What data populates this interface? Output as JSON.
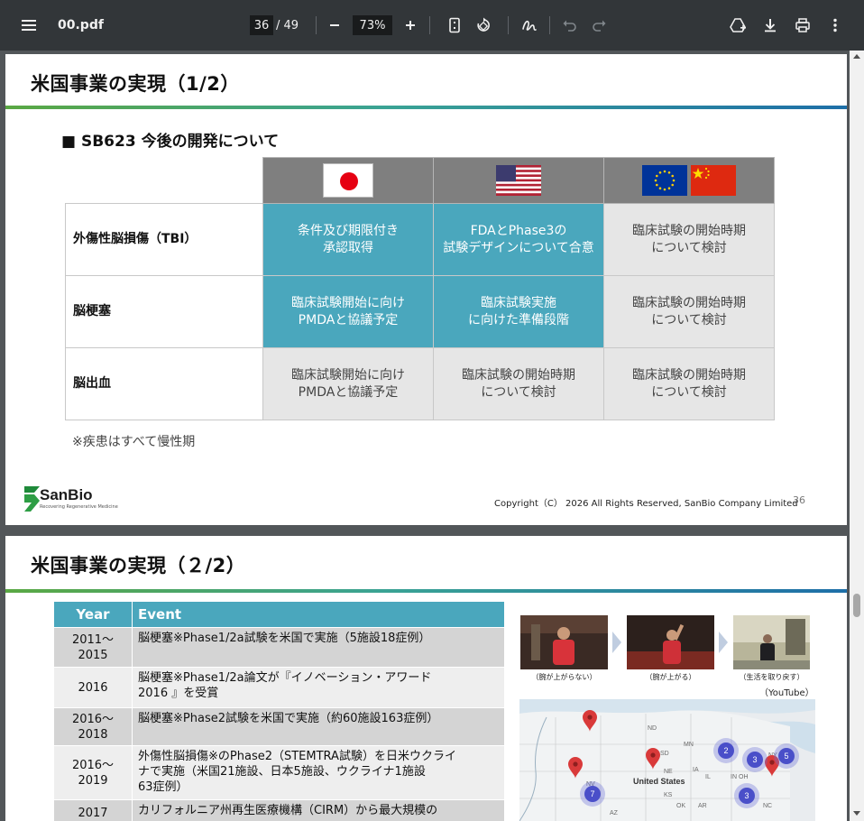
{
  "toolbar": {
    "title": "00.pdf",
    "current_page": "36",
    "total_pages": "/ 49",
    "zoom": "73%",
    "icons": [
      "menu-icon",
      "minus-icon",
      "plus-icon",
      "fit-page-icon",
      "rotate-icon",
      "annotate-icon",
      "undo-icon",
      "redo-icon",
      "drive-add-icon",
      "download-icon",
      "print-icon",
      "more-icon"
    ]
  },
  "slide1": {
    "title": "米国事業の実現（1/2）",
    "subtitle": "■ SB623 今後の開発について",
    "regions": [
      "japan-flag",
      "us-flag",
      "eu-flag",
      "china-flag"
    ],
    "rows": [
      {
        "label": "外傷性脳損傷（TBI）",
        "cells": [
          {
            "line1": "条件及び期限付き",
            "line2": "承認取得",
            "highlight": true
          },
          {
            "line1": "FDAとPhase3の",
            "line2": "試験デザインについて合意",
            "highlight": true
          },
          {
            "line1": "臨床試験の開始時期",
            "line2": "について検討",
            "highlight": false
          }
        ]
      },
      {
        "label": "脳梗塞",
        "cells": [
          {
            "line1": "臨床試験開始に向け",
            "line2": "PMDAと協議予定",
            "highlight": true
          },
          {
            "line1": "臨床試験実施",
            "line2": "に向けた準備段階",
            "highlight": true
          },
          {
            "line1": "臨床試験の開始時期",
            "line2": "について検討",
            "highlight": false
          }
        ]
      },
      {
        "label": "脳出血",
        "cells": [
          {
            "line1": "臨床試験開始に向け",
            "line2": "PMDAと協議予定",
            "highlight": false
          },
          {
            "line1": "臨床試験の開始時期",
            "line2": "について検討",
            "highlight": false
          },
          {
            "line1": "臨床試験の開始時期",
            "line2": "について検討",
            "highlight": false
          }
        ]
      }
    ],
    "note": "※疾患はすべて慢性期",
    "logo_text": "SanBio",
    "logo_tagline": "Recovering Regenerative Medicine",
    "copyright": "Copyright（C） 2026 All Rights Reserved, SanBio Company Limited",
    "page_number": "36"
  },
  "slide2": {
    "title": "米国事業の実現（２/2）",
    "table_headers": {
      "year": "Year",
      "event": "Event"
    },
    "events": [
      {
        "year1": "2011～",
        "year2": "2015",
        "lines": [
          "脳梗塞※Phase1/2a試験を米国で実施（5施設18症例）"
        ]
      },
      {
        "year1": "2016",
        "year2": "",
        "lines": [
          "脳梗塞※Phase1/2a論文が『イノベーション・アワード",
          "2016 』を受賞"
        ]
      },
      {
        "year1": "2016～",
        "year2": "2018",
        "lines": [
          "脳梗塞※Phase2試験を米国で実施（約60施設163症例）"
        ]
      },
      {
        "year1": "2016～",
        "year2": "2019",
        "lines": [
          "外傷性脳損傷※のPhase2（STEMTRA試験）を日米ウクライ",
          "ナで実施（米国21施設、日本5施設、ウクライナ1施設",
          "63症例）"
        ]
      },
      {
        "year1": "2017",
        "year2": "",
        "lines": [
          "カリフォルニア州再生医療機構（CIRM）から最大規模の"
        ]
      }
    ],
    "video_captions": [
      "（腕が上がらない）",
      "（腕が上がる）",
      "（生活を取り戻す）"
    ],
    "video_source": "（YouTube）",
    "map": {
      "country_label": "United States",
      "state_labels": [
        "ND",
        "MN",
        "SD",
        "NE",
        "IA",
        "IL",
        "IN",
        "OH",
        "NY",
        "NV",
        "OK",
        "AR",
        "NC",
        "AZ",
        "KS"
      ],
      "cluster_counts": [
        "2",
        "3",
        "5",
        "7",
        "3"
      ]
    }
  }
}
